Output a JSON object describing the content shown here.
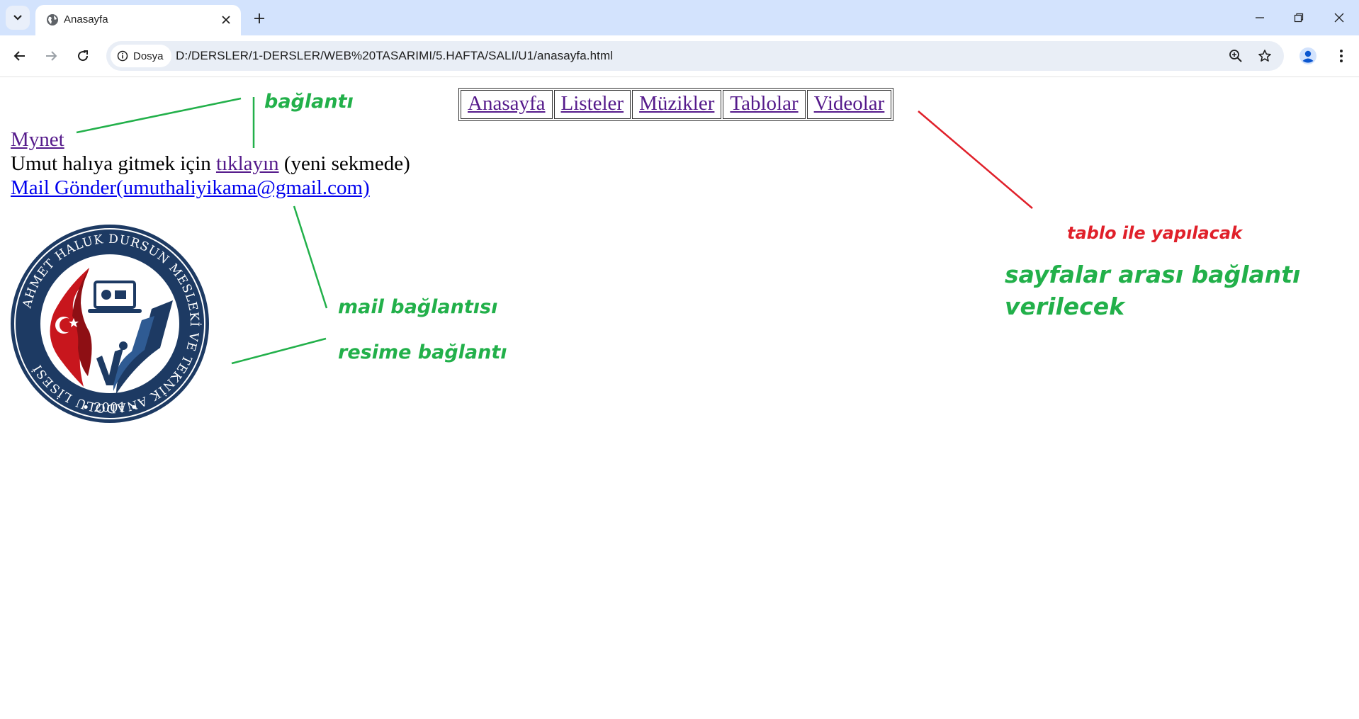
{
  "browser": {
    "tab_title": "Anasayfa",
    "site_chip": "Dosya",
    "url": "D:/DERSLER/1-DERSLER/WEB%20TASARIMI/5.HAFTA/SALI/U1/anasayfa.html"
  },
  "page": {
    "link_mynet": "Mynet",
    "line2_prefix": "Umut halıya gitmek için ",
    "line2_link": "tıklayın",
    "line2_suffix": " (yeni sekmede)",
    "mail_link_1": "Mail Gönder",
    "mail_link_2": "(umuthaliyikama@gmail.com)",
    "nav_items": [
      "Anasayfa",
      "Listeler",
      "Müzikler",
      "Tablolar",
      "Videolar"
    ],
    "logo": {
      "ring_text": "AHMET HALUK DURSUN MESLEKİ VE TEKNİK ANADOLU LİSESİ",
      "year": "• 2001 •"
    }
  },
  "annotations": {
    "baglanti": "bağlantı",
    "mail_baglantisi": "mail bağlantısı",
    "resime_baglanti": "resime bağlantı",
    "tablo_ile": "tablo ile yapılacak",
    "sayfalar_line1": "sayfalar arası bağlantı",
    "sayfalar_line2": "verilecek"
  },
  "colors": {
    "annotation_green": "#22b04a",
    "annotation_red": "#e0202a",
    "visited_link": "#551a8b",
    "link": "#0000ee",
    "logo_navy": "#1d3a63"
  }
}
